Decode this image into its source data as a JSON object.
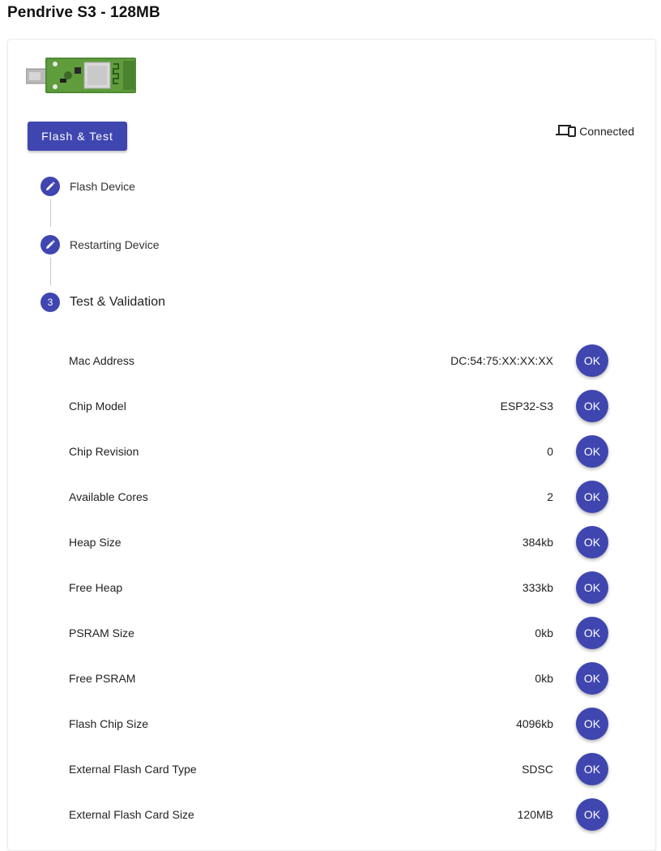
{
  "title": "Pendrive S3 - 128MB",
  "flash_button_label": "Flash & Test",
  "connection_status": "Connected",
  "device_image": "esp32-s3-usb-stick-photo",
  "accent_color": "#3f46b0",
  "steps": [
    {
      "label": "Flash Device",
      "icon": "pencil-icon",
      "state": "done"
    },
    {
      "label": "Restarting Device",
      "icon": "pencil-icon",
      "state": "done"
    },
    {
      "label": "Test & Validation",
      "number": "3",
      "state": "active"
    }
  ],
  "tests": [
    {
      "label": "Mac Address",
      "value": "DC:54:75:XX:XX:XX",
      "result": "OK"
    },
    {
      "label": "Chip Model",
      "value": "ESP32-S3",
      "result": "OK"
    },
    {
      "label": "Chip Revision",
      "value": "0",
      "result": "OK"
    },
    {
      "label": "Available Cores",
      "value": "2",
      "result": "OK"
    },
    {
      "label": "Heap Size",
      "value": "384kb",
      "result": "OK"
    },
    {
      "label": "Free Heap",
      "value": "333kb",
      "result": "OK"
    },
    {
      "label": "PSRAM Size",
      "value": "0kb",
      "result": "OK"
    },
    {
      "label": "Free PSRAM",
      "value": "0kb",
      "result": "OK"
    },
    {
      "label": "Flash Chip Size",
      "value": "4096kb",
      "result": "OK"
    },
    {
      "label": "External Flash Card Type",
      "value": "SDSC",
      "result": "OK"
    },
    {
      "label": "External Flash Card Size",
      "value": "120MB",
      "result": "OK"
    }
  ]
}
